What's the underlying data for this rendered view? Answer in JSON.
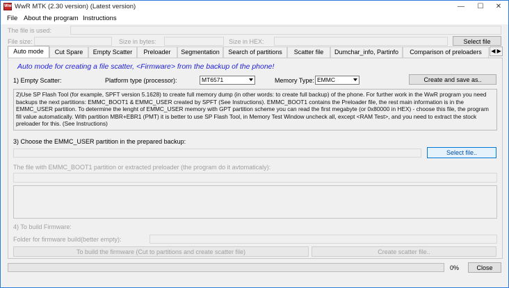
{
  "window": {
    "title": "WwR MTK (2.30 version) (Latest version)",
    "icon_text": "WwR",
    "controls": {
      "minimize": "—",
      "maximize": "☐",
      "close": "✕"
    }
  },
  "menu": {
    "file": "File",
    "about": "About the program",
    "instructions": "Instructions"
  },
  "header": {
    "file_used_label": "The file is used:",
    "file_size_label": "File size:",
    "size_bytes_label": "Size in bytes:",
    "size_hex_label": "Size in HEX:",
    "select_file_button": "Select file"
  },
  "tabs": [
    "Auto mode",
    "Cut Spare",
    "Empty Scatter",
    "Preloader",
    "Segmentation",
    "Search of partitions",
    "Scatter file",
    "Dumchar_info, Partinfo",
    "Comparison of preloaders"
  ],
  "tab_scroll": "◀ ▶",
  "auto_mode": {
    "banner": "Auto mode for creating a file scatter, <Firmware> from the backup of the phone!",
    "step1_label": "1) Empty Scatter:",
    "platform_label": "Platform type (processor):",
    "platform_value": "MT6571",
    "memory_label": "Memory Type:",
    "memory_value": "EMMC",
    "create_button": "Create and save as..",
    "step2_text": "2)Use SP Flash Tool (for example, SPFT version 5.1628) to create full memory dump (in other words: to create full backup) of the phone. For further work in the WwR program you need backups the next partitions: EMMC_BOOT1 & EMMC_USER created by SPFT (See Instructions). EMMC_BOOT1 contains the Preloader file, the rest main information is in the EMMC_USER partition. To determine the lenght of EMMC_USER memory with GPT partition scheme you can read the first megabyte (or 0x80000 in HEX) - choose this file, the program fill value automatically. With partition MBR+EBR1 (PMT) it is better to use SP Flash Tool, in Memory Test Window uncheck all, except <RAM Test>, and you need to extract the stock preloader for this. (See Instructions)",
    "step3_label": "3) Choose the EMMC_USER partition in the prepared backup:",
    "select_file_button": "Select file..",
    "boot1_label": "The file with EMMC_BOOT1 partition or extracted preloader (the program do it avtomaticaly):",
    "step4_label": "4) To build Firmware:",
    "folder_label": "Folder for firmware build(better empty):",
    "build_button": "To build the firmware (Cut to partitions and create scatter file)",
    "create_scatter_button": "Create scatter file.."
  },
  "footer": {
    "progress": 0,
    "progress_label": "0%",
    "close_button": "Close"
  }
}
